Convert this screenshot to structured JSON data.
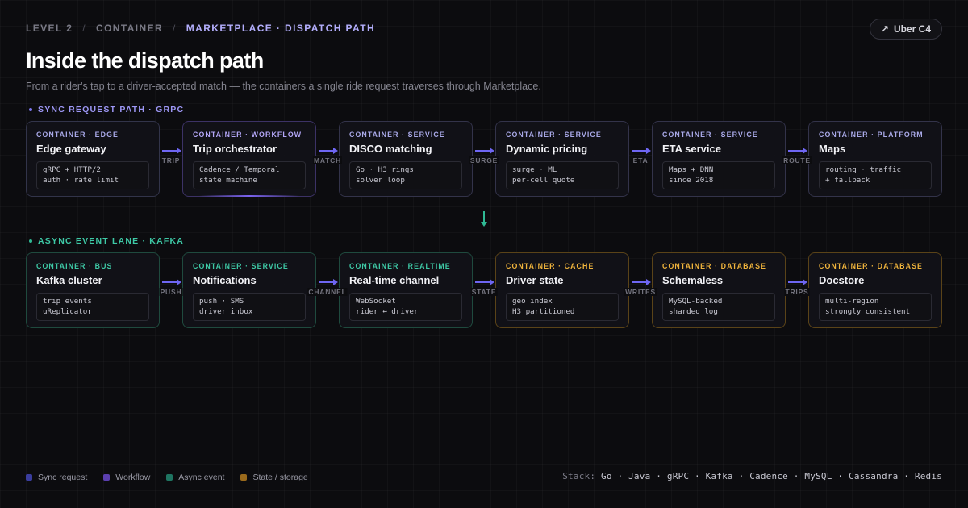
{
  "breadcrumb": {
    "level": "LEVEL 2",
    "separator": "/",
    "section": "CONTAINER",
    "current": "MARKETPLACE · DISPATCH PATH"
  },
  "badge": {
    "icon": "external-arrow-icon",
    "glyph": "↗",
    "label": "Uber C4"
  },
  "title": "Inside the dispatch path",
  "subtitle": "From a rider's tap to a driver-accepted match — the containers a single ride request traverses through Marketplace.",
  "sync_lane": {
    "label": "SYNC REQUEST PATH · GRPC",
    "cards": [
      {
        "kicker": "CONTAINER · EDGE",
        "name": "Edge gateway",
        "details": [
          "gRPC + HTTP/2",
          "auth · rate limit"
        ],
        "kind": "edge"
      },
      {
        "kicker": "CONTAINER · WORKFLOW",
        "name": "Trip orchestrator",
        "details": [
          "Cadence / Temporal",
          "state machine"
        ],
        "kind": "workflow"
      },
      {
        "kicker": "CONTAINER · SERVICE",
        "name": "DISCO matching",
        "details": [
          "Go · H3 rings",
          "solver loop"
        ],
        "kind": "service"
      },
      {
        "kicker": "CONTAINER · SERVICE",
        "name": "Dynamic pricing",
        "details": [
          "surge · ML",
          "per-cell quote"
        ],
        "kind": "service"
      },
      {
        "kicker": "CONTAINER · SERVICE",
        "name": "ETA service",
        "details": [
          "Maps + DNN",
          "since 2018"
        ],
        "kind": "service"
      },
      {
        "kicker": "CONTAINER · PLATFORM",
        "name": "Maps",
        "details": [
          "routing · traffic",
          "+ fallback"
        ],
        "kind": "platform"
      }
    ],
    "connectors": [
      "TRIP",
      "MATCH",
      "SURGE",
      "ETA",
      "ROUTE"
    ]
  },
  "async_lane": {
    "label": "ASYNC EVENT LANE · KAFKA",
    "cards": [
      {
        "kicker": "CONTAINER · BUS",
        "name": "Kafka cluster",
        "details": [
          "trip events",
          "uReplicator"
        ],
        "kind": "async"
      },
      {
        "kicker": "CONTAINER · SERVICE",
        "name": "Notifications",
        "details": [
          "push · SMS",
          "driver inbox"
        ],
        "kind": "async"
      },
      {
        "kicker": "CONTAINER · REALTIME",
        "name": "Real-time channel",
        "details": [
          "WebSocket",
          "rider ↔ driver"
        ],
        "kind": "async"
      },
      {
        "kicker": "CONTAINER · CACHE",
        "name": "Driver state",
        "details": [
          "geo index",
          "H3 partitioned"
        ],
        "kind": "state"
      },
      {
        "kicker": "CONTAINER · DATABASE",
        "name": "Schemaless",
        "details": [
          "MySQL-backed",
          "sharded log"
        ],
        "kind": "state"
      },
      {
        "kicker": "CONTAINER · DATABASE",
        "name": "Docstore",
        "details": [
          "multi-region",
          "strongly consistent"
        ],
        "kind": "state"
      }
    ],
    "connectors": [
      "PUSH",
      "CHANNEL",
      "STATE",
      "WRITES",
      "TRIPS"
    ]
  },
  "legend": [
    {
      "label": "Sync request",
      "color": "#3a3d9e"
    },
    {
      "label": "Workflow",
      "color": "#5b3fb0"
    },
    {
      "label": "Async event",
      "color": "#1f7562"
    },
    {
      "label": "State / storage",
      "color": "#9a6a1c"
    }
  ],
  "stack": {
    "prefix": "Stack:",
    "items": "Go · Java · gRPC · Kafka · Cadence · MySQL · Cassandra · Redis"
  },
  "colors": {
    "background": "#0c0c0f",
    "sync_accent": "#7d77f0",
    "async_accent": "#2fb994",
    "state_accent": "#f0b43c"
  }
}
